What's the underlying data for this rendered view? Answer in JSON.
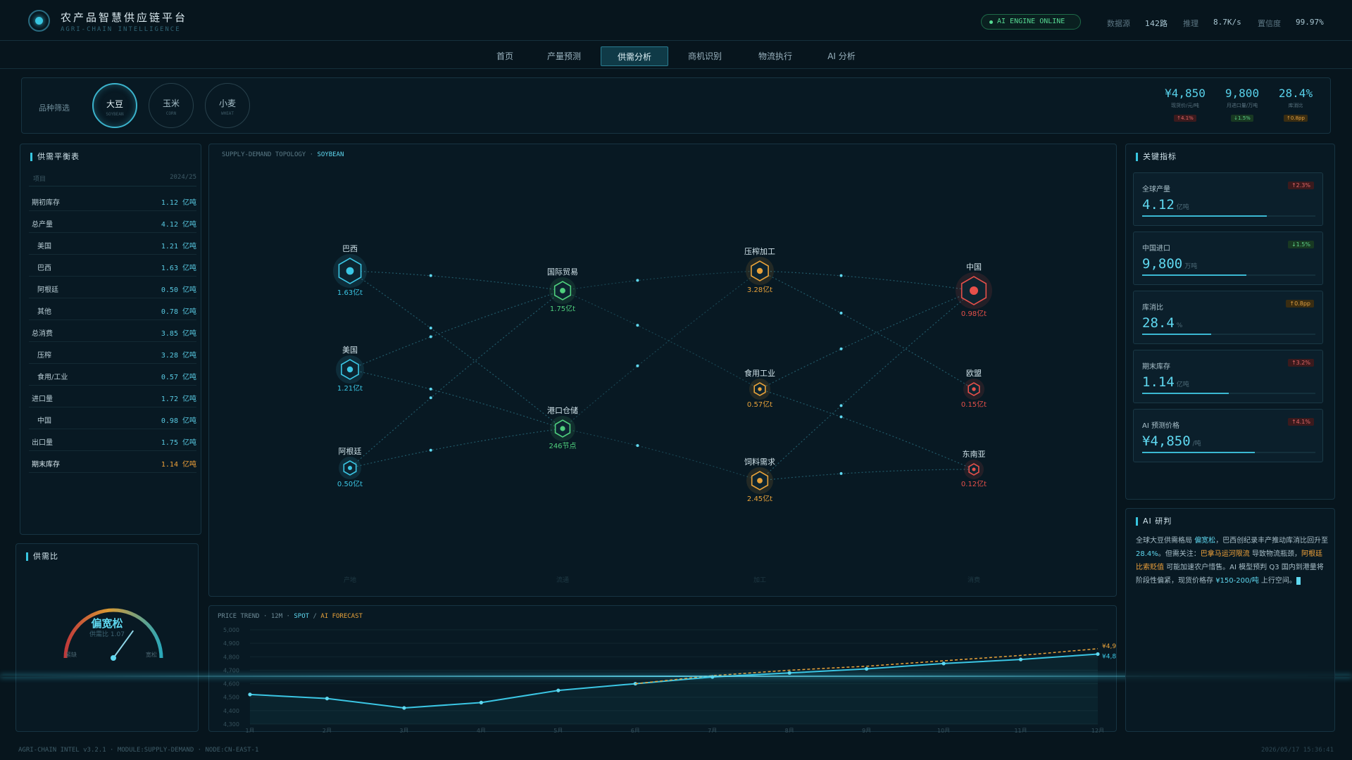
{
  "header": {
    "title": "农产品智慧供应链平台",
    "subtitle": "AGRI-CHAIN INTELLIGENCE",
    "engine_status": "AI ENGINE ONLINE",
    "stats": [
      {
        "label": "数据源",
        "value": "142路"
      },
      {
        "label": "推理",
        "value": "8.7K/s"
      },
      {
        "label": "置信度",
        "value": "99.97%"
      }
    ]
  },
  "nav": {
    "tabs": [
      "首页",
      "产量预测",
      "供需分析",
      "商机识别",
      "物流执行",
      "AI 分析"
    ],
    "active_index": 2
  },
  "variety": {
    "label": "品种筛选",
    "items": [
      {
        "name": "大豆",
        "en": "SOYBEAN",
        "active": true
      },
      {
        "name": "玉米",
        "en": "CORN",
        "active": false
      },
      {
        "name": "小麦",
        "en": "WHEAT",
        "active": false
      }
    ],
    "kpis": [
      {
        "value": "¥4,850",
        "label": "现货价/元/吨",
        "change": "↑4.1%",
        "trend": "up"
      },
      {
        "value": "9,800",
        "label": "月进口量/万吨",
        "change": "↓1.5%",
        "trend": "down"
      },
      {
        "value": "28.4%",
        "label": "库消比",
        "change": "↑0.8pp",
        "trend": "amber"
      }
    ]
  },
  "balance": {
    "title": "供需平衡表",
    "col_item": "项目",
    "col_year": "2024/25",
    "rows": [
      {
        "label": "期初库存",
        "value": "1.12 亿吨",
        "indent": 0
      },
      {
        "label": "总产量",
        "value": "4.12 亿吨",
        "indent": 0
      },
      {
        "label": "美国",
        "value": "1.21 亿吨",
        "indent": 1
      },
      {
        "label": "巴西",
        "value": "1.63 亿吨",
        "indent": 1
      },
      {
        "label": "阿根廷",
        "value": "0.50 亿吨",
        "indent": 1
      },
      {
        "label": "其他",
        "value": "0.78 亿吨",
        "indent": 1
      },
      {
        "label": "总消费",
        "value": "3.85 亿吨",
        "indent": 0
      },
      {
        "label": "压榨",
        "value": "3.28 亿吨",
        "indent": 1
      },
      {
        "label": "食用/工业",
        "value": "0.57 亿吨",
        "indent": 1
      },
      {
        "label": "进口量",
        "value": "1.72 亿吨",
        "indent": 0
      },
      {
        "label": "中国",
        "value": "0.98 亿吨",
        "indent": 1
      },
      {
        "label": "出口量",
        "value": "1.75 亿吨",
        "indent": 0
      },
      {
        "label": "期末库存",
        "value": "1.14 亿吨",
        "indent": 0
      }
    ]
  },
  "ratio": {
    "title": "供需比",
    "status": "偏宽松",
    "value_text": "供需比 1.07",
    "left_label": "紧缺",
    "right_label": "宽松",
    "level": 0.7
  },
  "topology": {
    "caption_prefix": "SUPPLY-DEMAND TOPOLOGY · ",
    "caption_variety": "SOYBEAN",
    "column_labels": [
      "产地",
      "流通",
      "加工",
      "消费"
    ],
    "nodes": [
      {
        "id": "brazil",
        "name": "巴西",
        "value": "1.63亿t",
        "color": "#3bc6e4"
      },
      {
        "id": "usa",
        "name": "美国",
        "value": "1.21亿t",
        "color": "#3bc6e4"
      },
      {
        "id": "argentina",
        "name": "阿根廷",
        "value": "0.50亿t",
        "color": "#3bc6e4"
      },
      {
        "id": "trade",
        "name": "国际贸易",
        "value": "1.75亿t",
        "color": "#4fcf7d"
      },
      {
        "id": "port",
        "name": "港口仓储",
        "value": "246节点",
        "color": "#4fcf7d"
      },
      {
        "id": "crush",
        "name": "压榨加工",
        "value": "3.28亿t",
        "color": "#e8a23a"
      },
      {
        "id": "food",
        "name": "食用工业",
        "value": "0.57亿t",
        "color": "#e8a23a"
      },
      {
        "id": "feed",
        "name": "饲料需求",
        "value": "2.45亿t",
        "color": "#e8a23a"
      },
      {
        "id": "china",
        "name": "中国",
        "value": "0.98亿t",
        "color": "#e5504a"
      },
      {
        "id": "eu",
        "name": "欧盟",
        "value": "0.15亿t",
        "color": "#e5504a"
      },
      {
        "id": "sea",
        "name": "东南亚",
        "value": "0.12亿t",
        "color": "#e5504a"
      }
    ]
  },
  "price": {
    "caption_prefix": "PRICE TREND · 12M · ",
    "caption_spot": "SPOT",
    "caption_sep": " / ",
    "caption_ai": "AI FORECAST",
    "end_labels": [
      "¥4,9",
      "¥4,8"
    ]
  },
  "chart_data": {
    "type": "line",
    "x": [
      "1月",
      "2月",
      "3月",
      "4月",
      "5月",
      "6月",
      "7月",
      "8月",
      "9月",
      "10月",
      "11月",
      "12月"
    ],
    "ylim": [
      4300,
      5000
    ],
    "yticks": [
      5000,
      4900,
      4800,
      4700,
      4600,
      4500,
      4400,
      4300
    ],
    "ytick_labels": [
      "5,000",
      "4,900",
      "4,800",
      "4,700",
      "4,600",
      "4,500",
      "4,400",
      "4,300"
    ],
    "series": [
      {
        "name": "SPOT",
        "color": "#3bc6e4",
        "values": [
          4520,
          4490,
          4420,
          4460,
          4550,
          4600,
          4650,
          4680,
          4710,
          4750,
          4780,
          4820
        ]
      },
      {
        "name": "AI FORECAST",
        "color": "#e8a23a",
        "values": [
          null,
          null,
          null,
          null,
          null,
          4600,
          4660,
          4700,
          4730,
          4770,
          4810,
          4860
        ]
      }
    ]
  },
  "key_metrics": {
    "title": "关键指标",
    "cards": [
      {
        "label": "全球产量",
        "value": "4.12",
        "unit": "亿吨",
        "change": "↑2.3%",
        "trend": "up",
        "fill": 0.72
      },
      {
        "label": "中国进口",
        "value": "9,800",
        "unit": "万吨",
        "change": "↓1.5%",
        "trend": "down",
        "fill": 0.6
      },
      {
        "label": "库消比",
        "value": "28.4",
        "unit": "%",
        "change": "↑0.8pp",
        "trend": "amber",
        "fill": 0.4
      },
      {
        "label": "期末库存",
        "value": "1.14",
        "unit": "亿吨",
        "change": "↑3.2%",
        "trend": "up",
        "fill": 0.5
      },
      {
        "label": "AI 预测价格",
        "value": "¥4,850",
        "unit": "/吨",
        "change": "↑4.1%",
        "trend": "up",
        "fill": 0.65
      }
    ]
  },
  "ai": {
    "title": "AI 研判",
    "segments": [
      {
        "text": "全球大豆供需格局 ",
        "style": ""
      },
      {
        "text": "偏宽松",
        "style": "c"
      },
      {
        "text": "，巴西创纪录丰产推动库消比回升至 ",
        "style": ""
      },
      {
        "text": "28.4%",
        "style": "c"
      },
      {
        "text": "。但需关注：",
        "style": ""
      },
      {
        "text": "巴拿马运河限流",
        "style": "o"
      },
      {
        "text": " 导致物流瓶颈，",
        "style": ""
      },
      {
        "text": "阿根廷比索贬值",
        "style": "o"
      },
      {
        "text": " 可能加速农户惜售。AI 模型预判 Q3 国内到港量将阶段性偏紧，现货价格存 ",
        "style": ""
      },
      {
        "text": "¥150-200/吨",
        "style": "c"
      },
      {
        "text": " 上行空间。",
        "style": ""
      }
    ]
  },
  "footer": {
    "left": "AGRI-CHAIN INTEL v3.2.1 · MODULE:SUPPLY-DEMAND · NODE:CN-EAST-1",
    "right": "2026/05/17 15:36:41"
  },
  "colors": {
    "accent": "#3bc6e4",
    "green": "#4fcf7d",
    "orange": "#e8a23a",
    "red": "#e5504a",
    "background": "#07151d"
  }
}
